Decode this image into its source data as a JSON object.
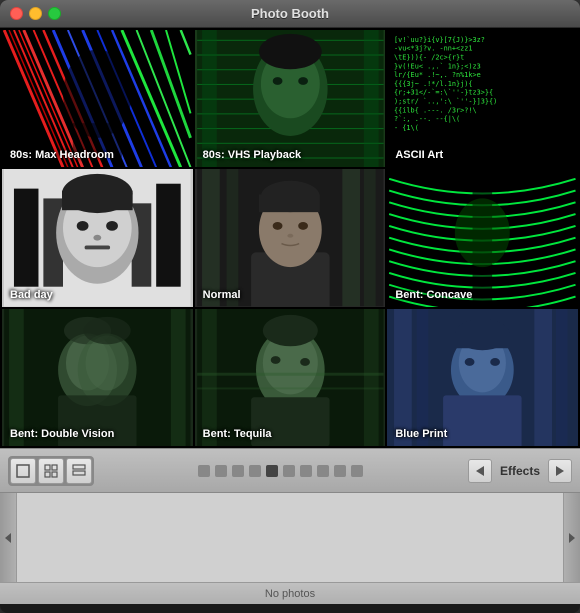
{
  "window": {
    "title": "Photo Booth"
  },
  "traffic_lights": {
    "close": "close",
    "minimize": "minimize",
    "maximize": "maximize"
  },
  "cells": [
    {
      "id": "max-headroom",
      "label": "80s: Max Headroom",
      "style": "max-headroom"
    },
    {
      "id": "vhs-playback",
      "label": "80s: VHS Playback",
      "style": "vhs"
    },
    {
      "id": "ascii-art",
      "label": "ASCII Art",
      "style": "ascii"
    },
    {
      "id": "bad-day",
      "label": "Bad day",
      "style": "bad-day"
    },
    {
      "id": "normal",
      "label": "Normal",
      "style": "normal"
    },
    {
      "id": "bent-concave",
      "label": "Bent: Concave",
      "style": "concave"
    },
    {
      "id": "bent-double-vision",
      "label": "Bent: Double Vision",
      "style": "double-vision"
    },
    {
      "id": "bent-tequila",
      "label": "Bent: Tequila",
      "style": "tequila"
    },
    {
      "id": "blue-print",
      "label": "Blue Print",
      "style": "blueprint"
    }
  ],
  "toolbar": {
    "view_buttons": [
      {
        "id": "single-view",
        "icon": "⊡"
      },
      {
        "id": "quad-view",
        "icon": "⊞"
      },
      {
        "id": "strip-view",
        "icon": "▦"
      }
    ],
    "dots": [
      false,
      false,
      false,
      false,
      true,
      false,
      false,
      false,
      false,
      false
    ],
    "effects_label": "Effects",
    "effects_prev": "◀",
    "effects_next": "▶"
  },
  "status": {
    "text": "No photos"
  }
}
